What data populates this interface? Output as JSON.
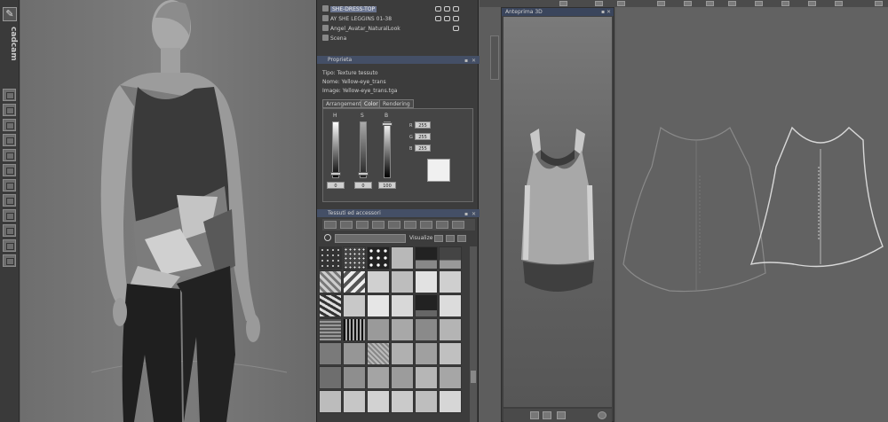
{
  "branding": {
    "logo_icon": "cadcam-logo-icon",
    "name": "cadcam"
  },
  "scene_tree": {
    "items": [
      {
        "label": "SHE-DRESS-TOP",
        "selected": true,
        "icon": "garment-icon"
      },
      {
        "label": "AY SHE LEGGINS 01-38",
        "selected": false,
        "icon": "garment-icon"
      },
      {
        "label": "Angel_Avatar_NaturalLook",
        "selected": false,
        "icon": "avatar-icon"
      },
      {
        "label": "Scena",
        "selected": false,
        "icon": "scene-icon"
      }
    ]
  },
  "properties": {
    "title": "Proprieta",
    "tipo_label": "Tipo:",
    "tipo_value": "Texture tessuto",
    "nome_label": "Nome:",
    "nome_value": "Yellow-eye_trans",
    "image_label": "Image:",
    "image_value": "Yellow-eye_trans.tga",
    "tabs": [
      "Arrangement",
      "Color",
      "Rendering"
    ],
    "active_tab": "Color",
    "channels": [
      {
        "label": "H",
        "value": "0",
        "knob": 0.95
      },
      {
        "label": "S",
        "value": "0",
        "knob": 0.95
      },
      {
        "label": "B",
        "value": "100",
        "knob": 0.02
      }
    ],
    "rgb": [
      {
        "label": "R",
        "value": "255"
      },
      {
        "label": "G",
        "value": "255"
      },
      {
        "label": "B",
        "value": "255"
      }
    ],
    "swatch_color": "#f0f0f0"
  },
  "fabrics": {
    "title": "Tessuti ed accessori",
    "search_placeholder": "",
    "visualize_label": "Visualize"
  },
  "preview": {
    "title": "Anteprima 3D"
  }
}
